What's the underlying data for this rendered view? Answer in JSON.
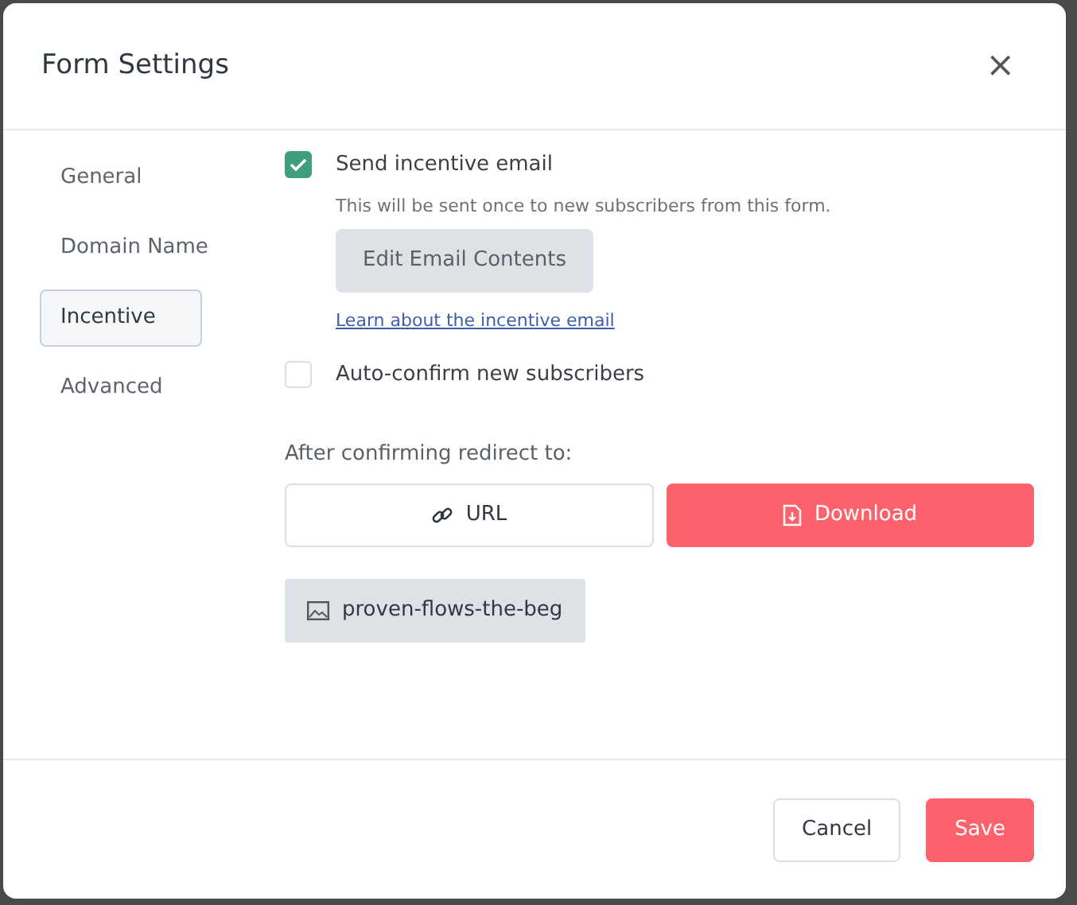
{
  "dialog": {
    "title": "Form Settings",
    "close": "×"
  },
  "sidebar": {
    "items": [
      {
        "label": "General",
        "selected": false
      },
      {
        "label": "Domain Name",
        "selected": false
      },
      {
        "label": "Incentive",
        "selected": true
      },
      {
        "label": "Advanced",
        "selected": false
      }
    ]
  },
  "incentive": {
    "checked": true,
    "label": "Send incentive email",
    "hint": "This will be sent once to new subscribers from this form.",
    "edit_button": "Edit Email Contents",
    "link": "Learn about the incentive email"
  },
  "auto_confirm": {
    "checked": false,
    "label": "Auto-confirm new subscribers"
  },
  "redirect": {
    "label": "After confirming redirect to:",
    "options": [
      {
        "kind": "link",
        "label": "URL",
        "selected": false
      },
      {
        "kind": "file",
        "label": "Download",
        "selected": true
      }
    ],
    "file": "proven-flows-the-beg"
  },
  "buttons": [
    {
      "kind": "secondary",
      "label": "Cancel"
    },
    {
      "kind": "primary",
      "label": "Save"
    }
  ]
}
